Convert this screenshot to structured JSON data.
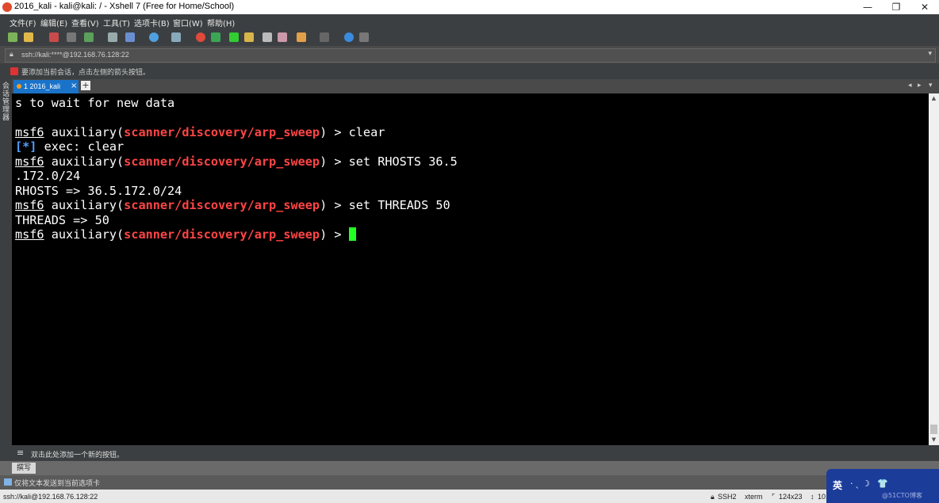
{
  "window": {
    "title": "2016_kali - kali@kali: / - Xshell 7 (Free for Home/School)",
    "minimize": "—",
    "maximize": "❐",
    "close": "✕"
  },
  "menu": {
    "items": [
      "文件(F)",
      "编辑(E)",
      "查看(V)",
      "工具(T)",
      "选项卡(B)",
      "窗口(W)",
      "帮助(H)"
    ]
  },
  "address": {
    "lock_icon": "lock-icon",
    "value": "ssh://kali:****@192.168.76.128:22"
  },
  "hint": {
    "text": "要添加当前会话，点击左侧的箭头按钮。"
  },
  "side_panel": {
    "label": "会话管理器"
  },
  "tabs": {
    "active_label": "1 2016_kali",
    "close": "×",
    "add": "+",
    "prev": "◂",
    "next": "▸",
    "menu": "▾"
  },
  "terminal": {
    "line0": "s to wait for new data",
    "prompt_msf": "msf6",
    "prompt_aux": " auxiliary(",
    "prompt_module": "scanner/discovery/arp_sweep",
    "prompt_end": ") > ",
    "cmd1": "clear",
    "info_tag": "[*]",
    "info_text": " exec: clear",
    "cmd2": "set RHOSTS 36.5",
    "cmd2_wrap": ".172.0/24",
    "out2": "RHOSTS => 36.5.172.0/24",
    "cmd3": "set THREADS 50",
    "out3": "THREADS => 50"
  },
  "quickbar": {
    "text": "双击此处添加一个新的按钮。"
  },
  "compose": {
    "button": "撰写"
  },
  "sendbar": {
    "text": "仅将文本发送到当前选项卡"
  },
  "status": {
    "connection": "ssh://kali@192.168.76.128:22",
    "protocol": "SSH2",
    "terminal_type": "xterm",
    "size": "124x23",
    "position": "10,"
  },
  "ime": {
    "lang": "英",
    "icons": "·ˎ☽ 👕",
    "watermark": "@51CTO博客"
  },
  "colors": {
    "prompt_module": "#ff4545",
    "info_tag": "#4ea0ff",
    "cursor": "#22ff22",
    "active_tab": "#1a73c9"
  }
}
